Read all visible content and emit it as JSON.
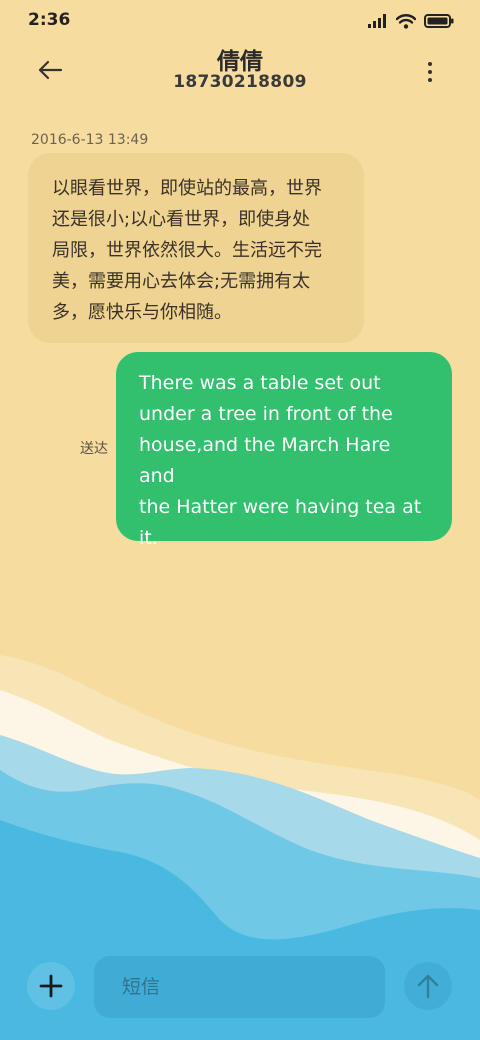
{
  "status_bar": {
    "time": "2:36",
    "icons": [
      "signal-icon",
      "wifi-icon",
      "battery-icon"
    ]
  },
  "header": {
    "title": "倩倩",
    "subtitle": "18730218809",
    "back_icon": "back-arrow-icon",
    "more_icon": "more-vertical-icon"
  },
  "conversation": {
    "timestamp": "2016-6-13 13:49",
    "incoming": {
      "lines": [
        "以眼看世界，即使站的最高，世界",
        "还是很小;以心看世界，即使身处",
        "局限，世界依然很大。生活远不完",
        "美，需要用心去体会;无需拥有太",
        "多，愿快乐与你相随。"
      ]
    },
    "outgoing": {
      "status": "送达",
      "lines": [
        "There was a table set out",
        "under a tree in front of the",
        "house,and the March Hare and",
        "the Hatter were having tea at",
        "it."
      ]
    }
  },
  "composer": {
    "placeholder": "短信",
    "value": "",
    "add_icon": "plus-icon",
    "send_icon": "send-arrow-up-icon"
  },
  "colors": {
    "background_sand": "#f7dc9f",
    "incoming_bubble": "#efd393",
    "outgoing_bubble": "#32c06e",
    "sea_light": "#a6d9ea",
    "sea_mid": "#6ec8e6",
    "sea_deep": "#4ab9e2",
    "foam": "#fdf6e6"
  }
}
